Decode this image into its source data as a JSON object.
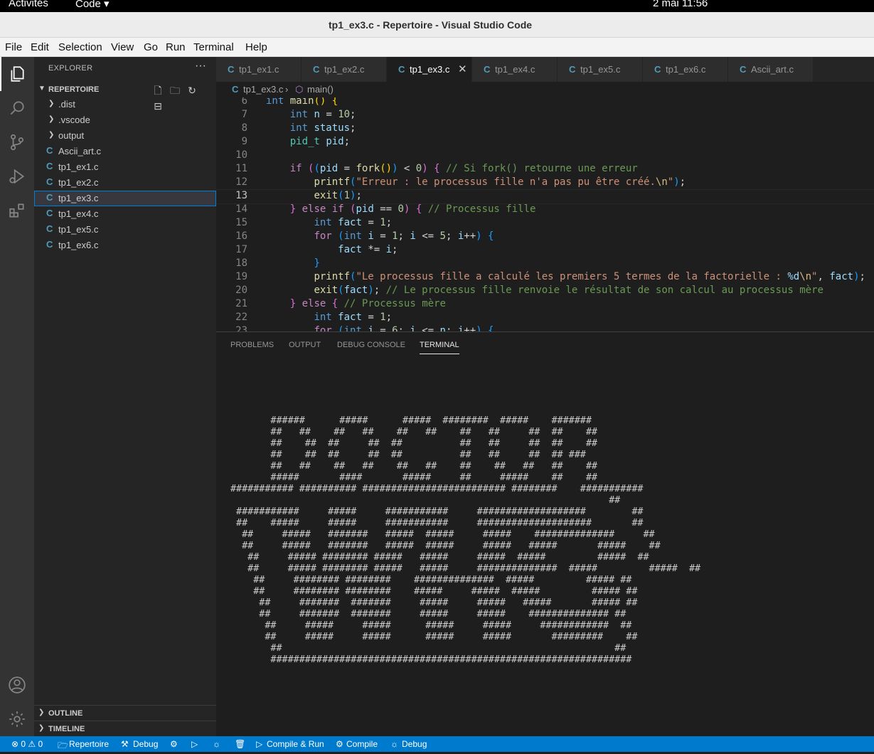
{
  "system": {
    "activities": "Activités",
    "app_menu": "Code ▾",
    "clock": "2 mai  11:56"
  },
  "window": {
    "title": "tp1_ex3.c - Repertoire - Visual Studio Code"
  },
  "menu": [
    "File",
    "Edit",
    "Selection",
    "View",
    "Go",
    "Run",
    "Terminal",
    "Help"
  ],
  "activity_bar": [
    "explorer-icon",
    "search-icon",
    "source-control-icon",
    "run-debug-icon",
    "extensions-icon",
    "account-icon",
    "settings-gear-icon"
  ],
  "explorer": {
    "title": "EXPLORER",
    "more": "···",
    "repo": "REPERTOIRE",
    "folders": [
      ".dist",
      ".vscode",
      "output"
    ],
    "files": [
      "Ascii_art.c",
      "tp1_ex1.c",
      "tp1_ex2.c",
      "tp1_ex3.c",
      "tp1_ex4.c",
      "tp1_ex5.c",
      "tp1_ex6.c"
    ],
    "selected": "tp1_ex3.c",
    "outline": "OUTLINE",
    "timeline": "TIMELINE"
  },
  "tabs": [
    "tp1_ex1.c",
    "tp1_ex2.c",
    "tp1_ex3.c",
    "tp1_ex4.c",
    "tp1_ex5.c",
    "tp1_ex6.c",
    "Ascii_art.c"
  ],
  "active_tab": "tp1_ex3.c",
  "breadcrumb": {
    "file": "tp1_ex3.c",
    "symbol": "main()"
  },
  "code": {
    "line_numbers": [
      "6",
      "7",
      "8",
      "9",
      "10",
      "11",
      "12",
      "13",
      "14",
      "15",
      "16",
      "17",
      "18",
      "19",
      "20",
      "21",
      "22",
      "23"
    ],
    "current_line": "13"
  },
  "panel": {
    "tabs": [
      "PROBLEMS",
      "OUTPUT",
      "DEBUG CONSOLE",
      "TERMINAL"
    ],
    "active": "TERMINAL",
    "terminal_lines": [
      "       ######      #####      #####  ########  #####    #######",
      "       ##   ##    ##   ##    ##   ##    ##   ##     ##  ##    ##",
      "       ##    ##  ##     ##  ##          ##   ##     ##  ##    ##",
      "       ##    ##  ##     ##  ##          ##   ##     ##  ## ###",
      "       ##   ##    ##   ##    ##   ##    ##    ##   ##   ##    ##",
      "       #####       ####       #####     ##     #####    ##    ##",
      "########### ########## ######################### ########    ###########",
      "                                                                  ##",
      " ###########     #####     ###########     ###################        ##",
      " ##    #####     #####     ###########     ####################       ##",
      "  ##     #####   #######   #####  #####     #####    ##############     ##",
      "  ##     #####   #######   #####  #####     #####   #####       #####    ##",
      "   ##     ##### ######## #####   #####     #####  #####         #####  ##",
      "   ##     ##### ######## #####   #####     ##############  #####         #####  ##",
      "    ##     ######## ########    ##############  #####         ##### ##",
      "    ##     ######## ########    #####     #####  #####         ##### ##",
      "     ##     #######  #######     #####     #####   #####       ##### ##",
      "     ##     #######  #######     #####     #####    ############## ##",
      "      ##     #####     #####      #####     #####     ############  ##",
      "      ##     #####     #####      #####     #####       #########    ##",
      "       ##                                                          ##",
      "       ###############################################################"
    ]
  },
  "status": {
    "problems": "⊗ 0 ⚠ 0",
    "folder": "Repertoire",
    "debug_tool": "Debug",
    "compile_run": "Compile & Run",
    "compile": "Compile",
    "debug": "Debug"
  }
}
